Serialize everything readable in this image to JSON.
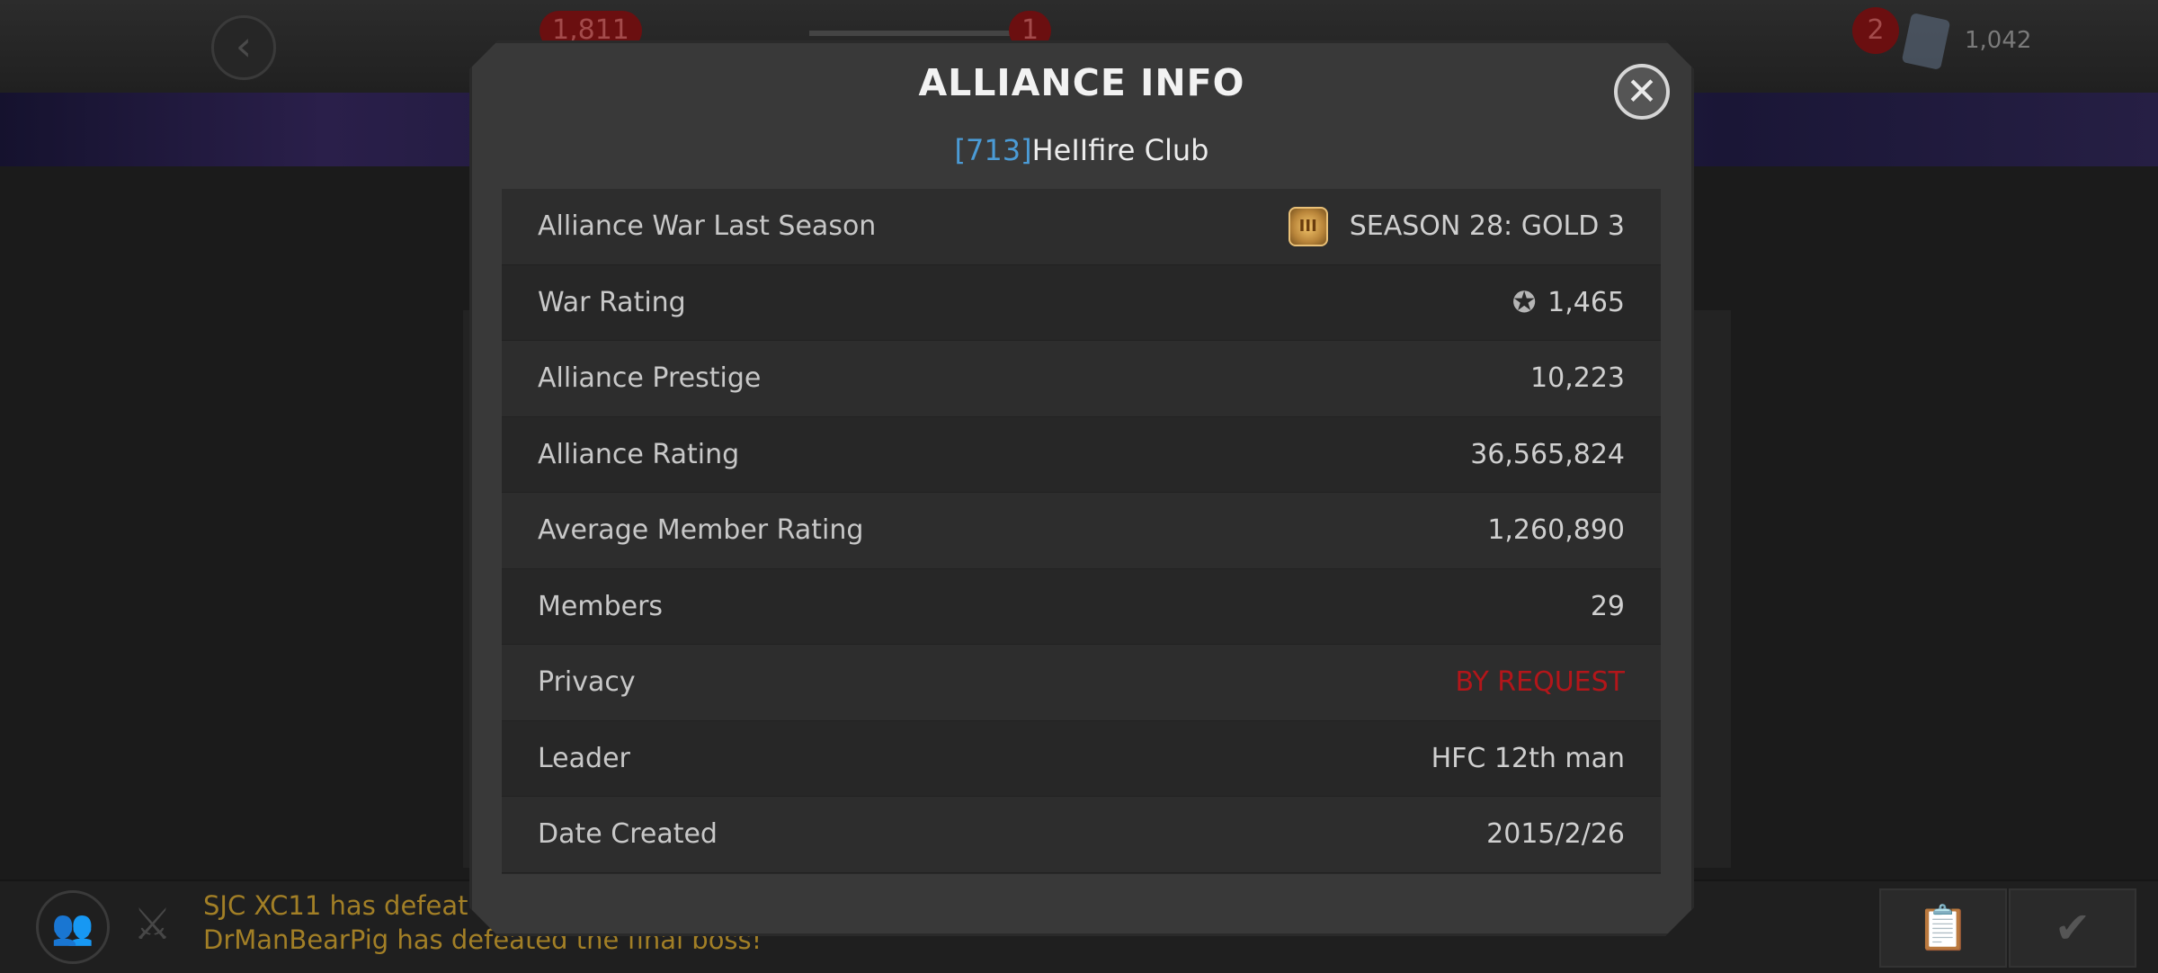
{
  "background": {
    "counter_left": "1,811",
    "counter_mid": "1",
    "badge_count": "2",
    "cards_count": "1,042",
    "feed": [
      "SJC XC11 has defeat",
      "DrManBearPig has defeated the final boss!"
    ]
  },
  "modal": {
    "title": "ALLIANCE INFO",
    "alliance_tag": "[713]",
    "alliance_name": "HeIIfire Club",
    "close_icon": "close-icon",
    "rows": [
      {
        "label": "Alliance War Last Season",
        "value": "SEASON 28: GOLD 3",
        "icon": "gold-tier-icon"
      },
      {
        "label": "War Rating",
        "value": "1,465",
        "icon": "war-rating-icon"
      },
      {
        "label": "Alliance Prestige",
        "value": "10,223"
      },
      {
        "label": "Alliance Rating",
        "value": "36,565,824"
      },
      {
        "label": "Average Member Rating",
        "value": "1,260,890"
      },
      {
        "label": "Members",
        "value": "29"
      },
      {
        "label": "Privacy",
        "value": "BY REQUEST",
        "color": "#b3161a"
      },
      {
        "label": "Leader",
        "value": "HFC 12th man"
      },
      {
        "label": "Date Created",
        "value": "2015/2/26"
      }
    ]
  }
}
